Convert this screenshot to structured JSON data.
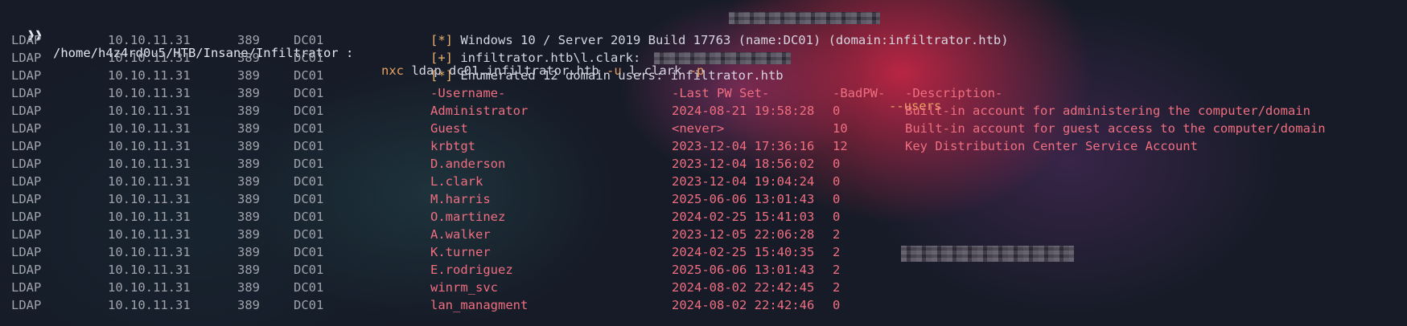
{
  "prompt": {
    "symbol": "❱❱",
    "cwd": "/home/h4z4rd0u5/HTB/Insane/Infiltrator",
    "separator": ":",
    "command": "nxc",
    "arg_proto": "ldap",
    "arg_host": "dc01.infiltrator.htb",
    "flag_u": "-u",
    "user": "l.clark",
    "flag_p": "-p",
    "flag_users": "--users"
  },
  "colors": {
    "background": "#161b27",
    "label_gray": "#a0a3ab",
    "accent_red": "#f06e80",
    "accent_orange": "#eaa060",
    "text_white": "#d6d6e2"
  },
  "info_lines": [
    {
      "proto": "LDAP",
      "ip": "10.10.11.31",
      "port": "389",
      "host": "DC01",
      "marker": "[*]",
      "text": "Windows 10 / Server 2019 Build 17763 (name:DC01) (domain:infiltrator.htb)"
    },
    {
      "proto": "LDAP",
      "ip": "10.10.11.31",
      "port": "389",
      "host": "DC01",
      "marker": "[+]",
      "text": "infiltrator.htb\\l.clark:"
    },
    {
      "proto": "LDAP",
      "ip": "10.10.11.31",
      "port": "389",
      "host": "DC01",
      "marker": "[*]",
      "text": "Enumerated 12 domain users: infiltrator.htb"
    }
  ],
  "table": {
    "proto": "LDAP",
    "ip": "10.10.11.31",
    "port": "389",
    "host": "DC01",
    "headers": {
      "username": "-Username-",
      "last_pw_set": "-Last PW Set-",
      "badpw": "-BadPW-",
      "description": "-Description-"
    },
    "rows": [
      {
        "username": "Administrator",
        "last_pw_set": "2024-08-21 19:58:28",
        "badpw": "0",
        "description": "Built-in account for administering the computer/domain"
      },
      {
        "username": "Guest",
        "last_pw_set": "<never>",
        "badpw": "10",
        "description": "Built-in account for guest access to the computer/domain"
      },
      {
        "username": "krbtgt",
        "last_pw_set": "2023-12-04 17:36:16",
        "badpw": "12",
        "description": "Key Distribution Center Service Account"
      },
      {
        "username": "D.anderson",
        "last_pw_set": "2023-12-04 18:56:02",
        "badpw": "0",
        "description": ""
      },
      {
        "username": "L.clark",
        "last_pw_set": "2023-12-04 19:04:24",
        "badpw": "0",
        "description": ""
      },
      {
        "username": "M.harris",
        "last_pw_set": "2025-06-06 13:01:43",
        "badpw": "0",
        "description": ""
      },
      {
        "username": "O.martinez",
        "last_pw_set": "2024-02-25 15:41:03",
        "badpw": "0",
        "description": ""
      },
      {
        "username": "A.walker",
        "last_pw_set": "2023-12-05 22:06:28",
        "badpw": "2",
        "description": ""
      },
      {
        "username": "K.turner",
        "last_pw_set": "2024-02-25 15:40:35",
        "badpw": "2",
        "description": ""
      },
      {
        "username": "E.rodriguez",
        "last_pw_set": "2025-06-06 13:01:43",
        "badpw": "2",
        "description": ""
      },
      {
        "username": "winrm_svc",
        "last_pw_set": "2024-08-02 22:42:45",
        "badpw": "2",
        "description": ""
      },
      {
        "username": "lan_managment",
        "last_pw_set": "2024-08-02 22:42:46",
        "badpw": "0",
        "description": ""
      }
    ]
  }
}
